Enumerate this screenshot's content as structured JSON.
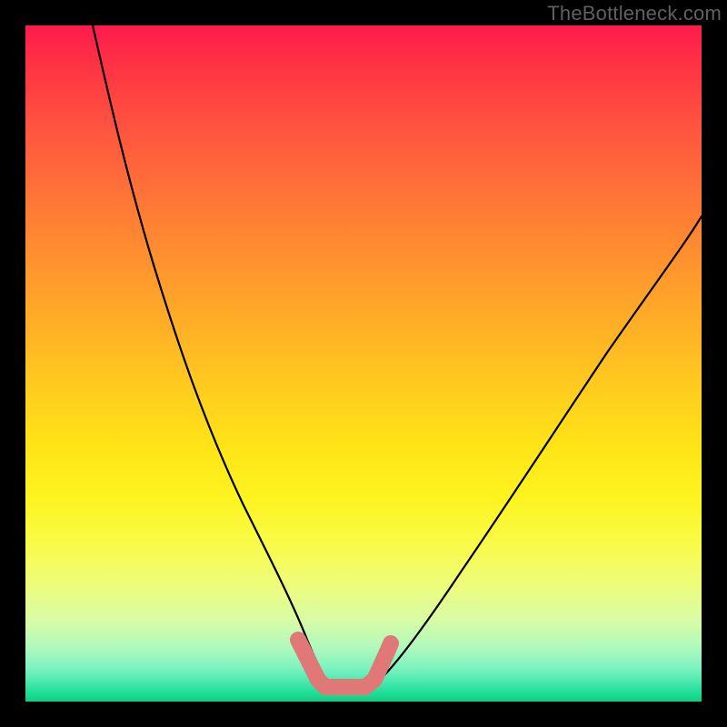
{
  "watermark": "TheBottleneck.com",
  "chart_data": {
    "type": "line",
    "title": "",
    "xlabel": "",
    "ylabel": "",
    "xlim": [
      0,
      100
    ],
    "ylim": [
      0,
      100
    ],
    "series": [
      {
        "name": "left-curve",
        "x": [
          10,
          12,
          15,
          18,
          22,
          26,
          30,
          34,
          37,
          40,
          42,
          44
        ],
        "y": [
          100,
          90,
          78,
          66,
          52,
          40,
          28,
          18,
          11,
          6,
          8,
          5
        ]
      },
      {
        "name": "right-curve",
        "x": [
          51,
          54,
          58,
          63,
          68,
          74,
          80,
          87,
          94,
          100
        ],
        "y": [
          5,
          8,
          13,
          20,
          28,
          36,
          45,
          55,
          64,
          72
        ]
      },
      {
        "name": "bottom-mark",
        "x": [
          40,
          42,
          44,
          46,
          48,
          50,
          51,
          52,
          53
        ],
        "y": [
          8,
          5,
          3,
          3,
          3,
          3,
          5,
          8,
          11
        ]
      }
    ],
    "colors": {
      "curve": "#000000",
      "mark": "#e07878",
      "gradient_top": "#ff1a4d",
      "gradient_mid": "#ffe317",
      "gradient_bottom": "#0ecf82"
    },
    "annotations": []
  }
}
